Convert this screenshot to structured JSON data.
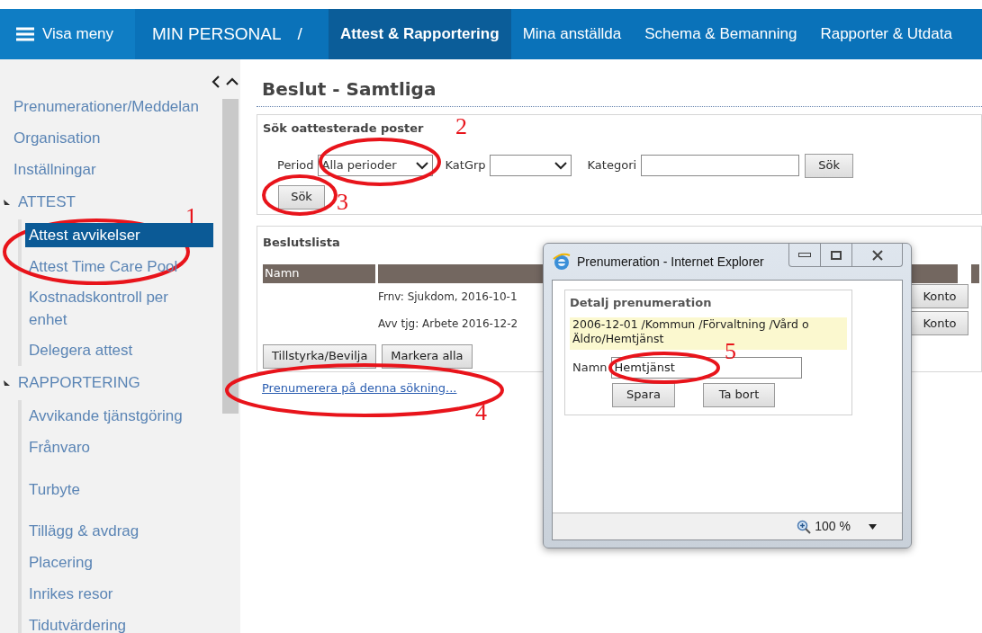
{
  "nav": {
    "menu_button": "Visa meny",
    "section": "MIN PERSONAL",
    "separator": "/",
    "tabs": [
      {
        "label": "Attest & Rapportering",
        "selected": true
      },
      {
        "label": "Mina anställda",
        "selected": false
      },
      {
        "label": "Schema & Bemanning",
        "selected": false
      },
      {
        "label": "Rapporter & Utdata",
        "selected": false
      }
    ]
  },
  "sidebar": {
    "items": [
      {
        "kind": "link",
        "label": "Prenumerationer/Meddelan"
      },
      {
        "kind": "link",
        "label": "Organisation"
      },
      {
        "kind": "link",
        "label": "Inställningar"
      },
      {
        "kind": "section",
        "label": "ATTEST",
        "expanded": true,
        "children": [
          {
            "label": "Attest avvikelser",
            "selected": true
          },
          {
            "label": "Attest Time Care Pool",
            "selected": false
          },
          {
            "label": "Kostnadskontroll per enhet",
            "selected": false
          },
          {
            "label": "Delegera attest",
            "selected": false
          }
        ]
      },
      {
        "kind": "section",
        "label": "RAPPORTERING",
        "expanded": true,
        "children": [
          {
            "label": "Avvikande tjänstgöring",
            "selected": false
          },
          {
            "label": "Frånvaro",
            "selected": false
          },
          {
            "label": "Turbyte",
            "selected": false
          },
          {
            "label": "Tillägg & avdrag",
            "selected": false
          },
          {
            "label": "Placering",
            "selected": false
          },
          {
            "label": "Inrikes resor",
            "selected": false
          },
          {
            "label": "Tidutvärdering",
            "selected": false
          }
        ]
      }
    ]
  },
  "page": {
    "title": "Beslut - Samtliga"
  },
  "search": {
    "title": "Sök oattesterade poster",
    "period_label": "Period",
    "period_value": "Alla perioder",
    "katgrp_label": "KatGrp",
    "kategori_label": "Kategori",
    "search_button": "Sök",
    "search_button_2": "Sök"
  },
  "decision_list": {
    "title": "Beslutslista",
    "columns": [
      "Namn"
    ],
    "rows": [
      {
        "description": "Frnv: Sjukdom, 2016-10-1",
        "action": "Konto"
      },
      {
        "description": "Avv tjg: Arbete 2016-12-2",
        "action": "Konto"
      }
    ],
    "buttons": [
      "Tillstyrka/Bevilja",
      "Markera alla"
    ]
  },
  "subscribe_link": "Prenumerera på denna sökning...",
  "popup": {
    "title": "Prenumeration - Internet Explorer",
    "section_title": "Detalj prenumeration",
    "path": "2006-12-01 /Kommun /Förvaltning /Vård o Äldro/Hemtjänst",
    "name_label": "Namn",
    "name_value": "Hemtjänst",
    "buttons": [
      "Spara",
      "Ta bort"
    ],
    "zoom": "100 %"
  },
  "annotations": [
    {
      "label": "1"
    },
    {
      "label": "2"
    },
    {
      "label": "3"
    },
    {
      "label": "4"
    },
    {
      "label": "5"
    }
  ]
}
